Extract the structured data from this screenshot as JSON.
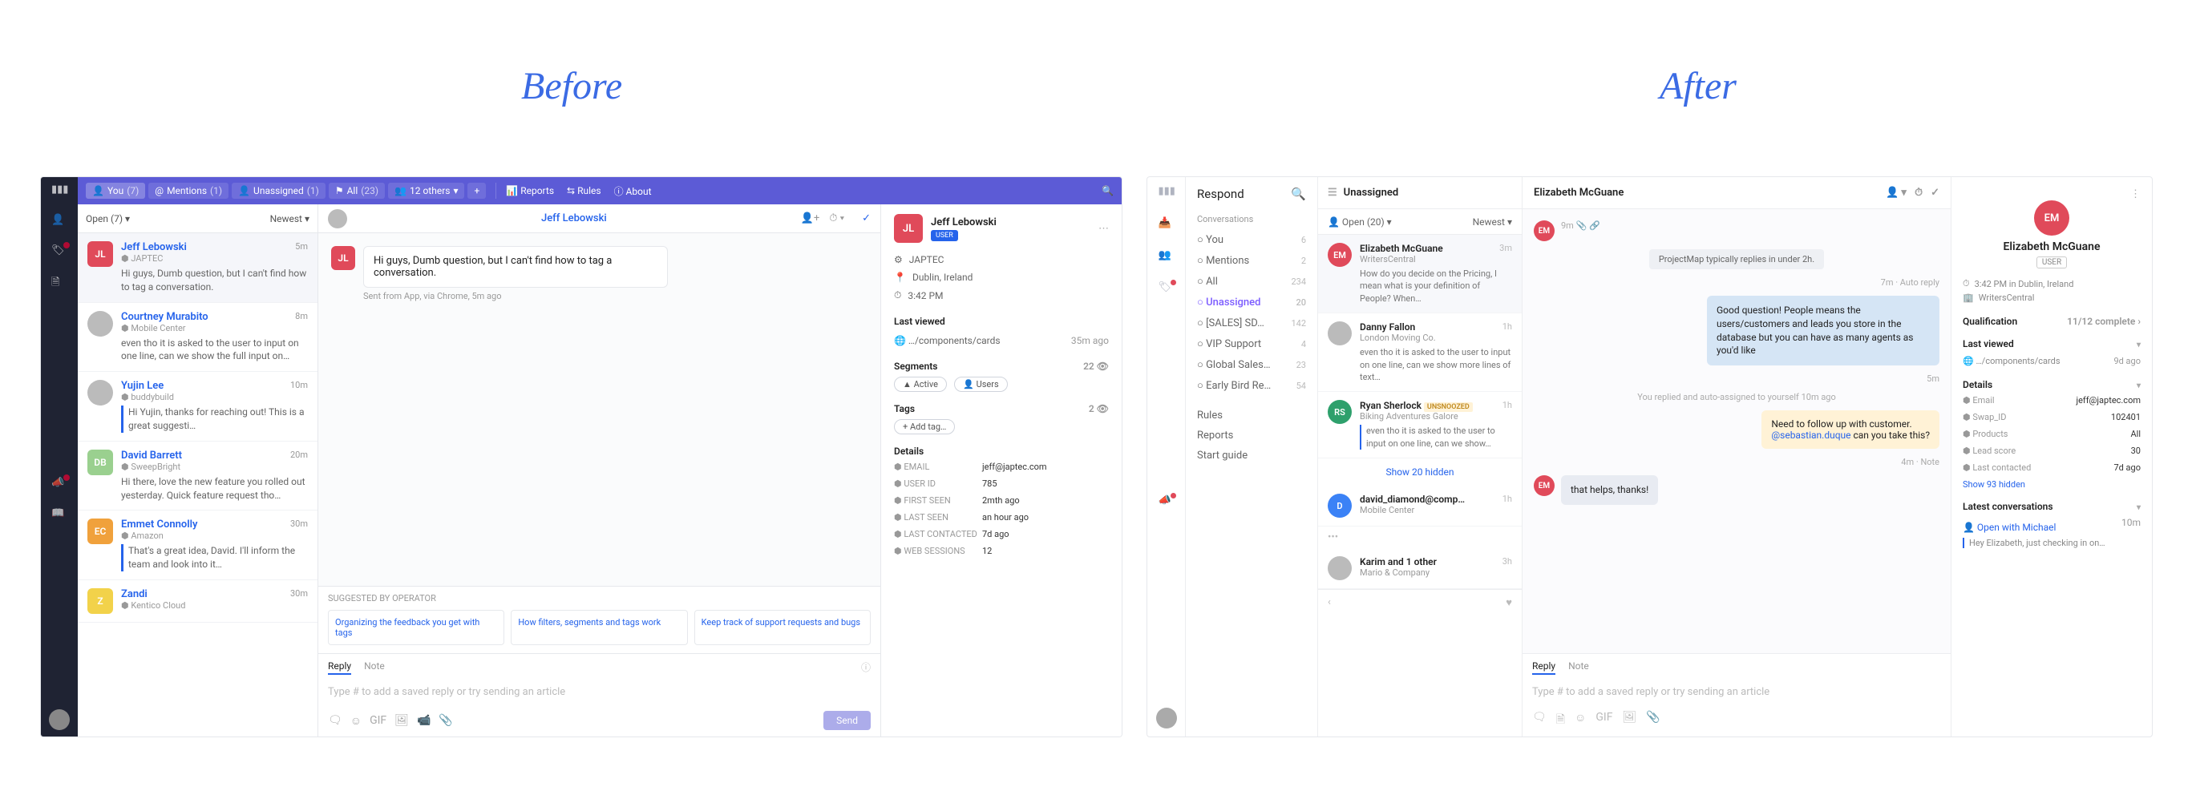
{
  "labels": {
    "before": "Before",
    "after": "After"
  },
  "before": {
    "topbar": {
      "you": "You",
      "you_count": "(7)",
      "mentions": "Mentions",
      "mentions_count": "(1)",
      "unassigned": "Unassigned",
      "unassigned_count": "(1)",
      "all": "All",
      "all_count": "(23)",
      "others": "12 others",
      "reports": "Reports",
      "rules": "Rules",
      "about": "About"
    },
    "inbox": {
      "filter": "Open (7)",
      "sort": "Newest",
      "items": [
        {
          "avatar": "JL",
          "name": "Jeff Lebowski",
          "time": "5m",
          "subtitle": "JAPTEC",
          "preview": "Hi guys, Dumb question, but I can't find how to tag a conversation.",
          "color": "#e04a5a",
          "active": true
        },
        {
          "avatar": "img",
          "name": "Courtney Murabito",
          "time": "8m",
          "subtitle": "Mobile Center",
          "preview": "even tho it is asked to the user to input on one line, can we show the full input on…"
        },
        {
          "avatar": "img",
          "name": "Yujin Lee",
          "time": "10m",
          "subtitle": "buddybuild",
          "preview": "Hi Yujin, thanks for reaching out! This is a great suggesti…",
          "reply": true
        },
        {
          "avatar": "DB",
          "name": "David Barrett",
          "time": "20m",
          "subtitle": "SweepBright",
          "preview": "Hi there, love the new feature you rolled out yesterday. Quick feature request tho…",
          "color": "#9ad08f"
        },
        {
          "avatar": "EC",
          "name": "Emmet Connolly",
          "time": "30m",
          "subtitle": "Amazon",
          "preview": "That's a great idea, David. I'll inform the team and look into it…",
          "color": "#f0a13c",
          "reply": true
        },
        {
          "avatar": "Z",
          "name": "Zandi",
          "time": "30m",
          "subtitle": "Kentico Cloud",
          "preview": "",
          "color": "#f2d24a"
        }
      ]
    },
    "conv": {
      "title": "Jeff Lebowski",
      "msg": {
        "avatar": "JL",
        "text": "Hi guys, Dumb question, but I can't find how to tag a conversation.",
        "meta": "Sent from App, via Chrome, 5m ago"
      },
      "suggest_title": "SUGGESTED BY OPERATOR",
      "suggestions": [
        "Organizing the feedback you get with tags",
        "How filters, segments and tags work",
        "Keep track of support requests and bugs"
      ],
      "compose": {
        "reply": "Reply",
        "note": "Note",
        "placeholder": "Type # to add a saved reply or try sending an article",
        "send": "Send"
      }
    },
    "side": {
      "name": "Jeff Lebowski",
      "badge": "USER",
      "meta": [
        "JAPTEC",
        "Dublin, Ireland",
        "3:42 PM"
      ],
      "last_viewed": "Last viewed",
      "last_viewed_item": "…/components/cards",
      "last_viewed_time": "35m ago",
      "segments_title": "Segments",
      "segments_count": "22",
      "segment_chips": [
        "Active",
        "Users"
      ],
      "tags_title": "Tags",
      "tags_count": "2",
      "add_tag": "+ Add tag…",
      "details_title": "Details",
      "details": [
        {
          "k": "EMAIL",
          "v": "jeff@japtec.com"
        },
        {
          "k": "USER ID",
          "v": "785"
        },
        {
          "k": "FIRST SEEN",
          "v": "2mth ago"
        },
        {
          "k": "LAST SEEN",
          "v": "an hour ago"
        },
        {
          "k": "LAST CONTACTED",
          "v": "7d ago"
        },
        {
          "k": "WEB SESSIONS",
          "v": "12"
        }
      ]
    }
  },
  "after": {
    "nav": {
      "title": "Respond",
      "conv_label": "Conversations",
      "rows": [
        {
          "label": "You",
          "count": "6"
        },
        {
          "label": "Mentions",
          "count": "2"
        },
        {
          "label": "All",
          "count": "234"
        },
        {
          "label": "Unassigned",
          "count": "20",
          "active": true
        },
        {
          "label": "[SALES] SD…",
          "count": "142"
        },
        {
          "label": "VIP Support",
          "count": "4"
        },
        {
          "label": "Global Sales…",
          "count": "23"
        },
        {
          "label": "Early Bird Re…",
          "count": "54"
        }
      ],
      "links": [
        "Rules",
        "Reports",
        "Start guide"
      ]
    },
    "inbox": {
      "title": "Unassigned",
      "filter": "Open (20)",
      "sort": "Newest",
      "items": [
        {
          "avatar": "EM",
          "color": "#e04a5a",
          "name": "Elizabeth McGuane",
          "time": "3m",
          "subtitle": "WritersCentral",
          "preview": "How do you decide on the Pricing, I mean what is your definition of People? When…",
          "active": true
        },
        {
          "avatar": "img",
          "name": "Danny Fallon",
          "time": "1h",
          "subtitle": "London Moving Co.",
          "preview": "even tho it is asked to the user to input on one line, can we show more lines of text…"
        },
        {
          "avatar": "RS",
          "color": "#2ea06c",
          "name": "Ryan Sherlock",
          "tag": "UNSNOOZED",
          "time": "1h",
          "subtitle": "Biking Adventures Galore",
          "preview": "even tho it is asked to the user to input on one line, can we show…",
          "reply": true
        },
        {
          "avatar": "D",
          "color": "#3b82f6",
          "name": "david_diamond@comp…",
          "time": "1h",
          "subtitle": "Mobile Center",
          "preview": ""
        },
        {
          "avatar": "img",
          "name": "Karim and 1 other",
          "time": "3h",
          "subtitle": "Mario & Company",
          "preview": ""
        }
      ],
      "show_hidden": "Show 20 hidden",
      "more": "•••"
    },
    "conv": {
      "title": "Elizabeth McGuane",
      "sys1": "ProjectMap typically replies in under 2h.",
      "sys2": "7m · Auto reply",
      "msg1": "Good question! People means the users/customers and leads you store in the database but you can have as many agents as you'd like",
      "msg1_time": "5m",
      "syscenter": "You replied and auto-assigned to yourself 10m ago",
      "note": {
        "text": "Need to follow up with customer.",
        "mention": "@sebastian.duque",
        "rest": " can you take this?"
      },
      "note_meta": "4m · Note",
      "msg2": "that helps, thanks!",
      "top_meta": "9m",
      "compose": {
        "reply": "Reply",
        "note": "Note",
        "placeholder": "Type # to add a saved reply or try sending an article"
      }
    },
    "side": {
      "avatar": "EM",
      "name": "Elizabeth McGuane",
      "badge": "USER",
      "meta": [
        "3:42 PM in Dublin, Ireland",
        "WritersCentral"
      ],
      "qual_title": "Qualification",
      "qual_val": "11/12 complete",
      "lv_title": "Last viewed",
      "lv_item": "…/components/cards",
      "lv_time": "9d ago",
      "details_title": "Details",
      "details": [
        {
          "k": "Email",
          "v": "jeff@japtec.com"
        },
        {
          "k": "Swap_ID",
          "v": "102401"
        },
        {
          "k": "Products",
          "v": "All"
        },
        {
          "k": "Lead score",
          "v": "30"
        },
        {
          "k": "Last contacted",
          "v": "7d ago"
        }
      ],
      "show_hidden": "Show 93 hidden",
      "latest_title": "Latest conversations",
      "latest_name": "Open with Michael",
      "latest_time": "10m",
      "latest_preview": "Hey Elizabeth, just checking in on…"
    }
  }
}
